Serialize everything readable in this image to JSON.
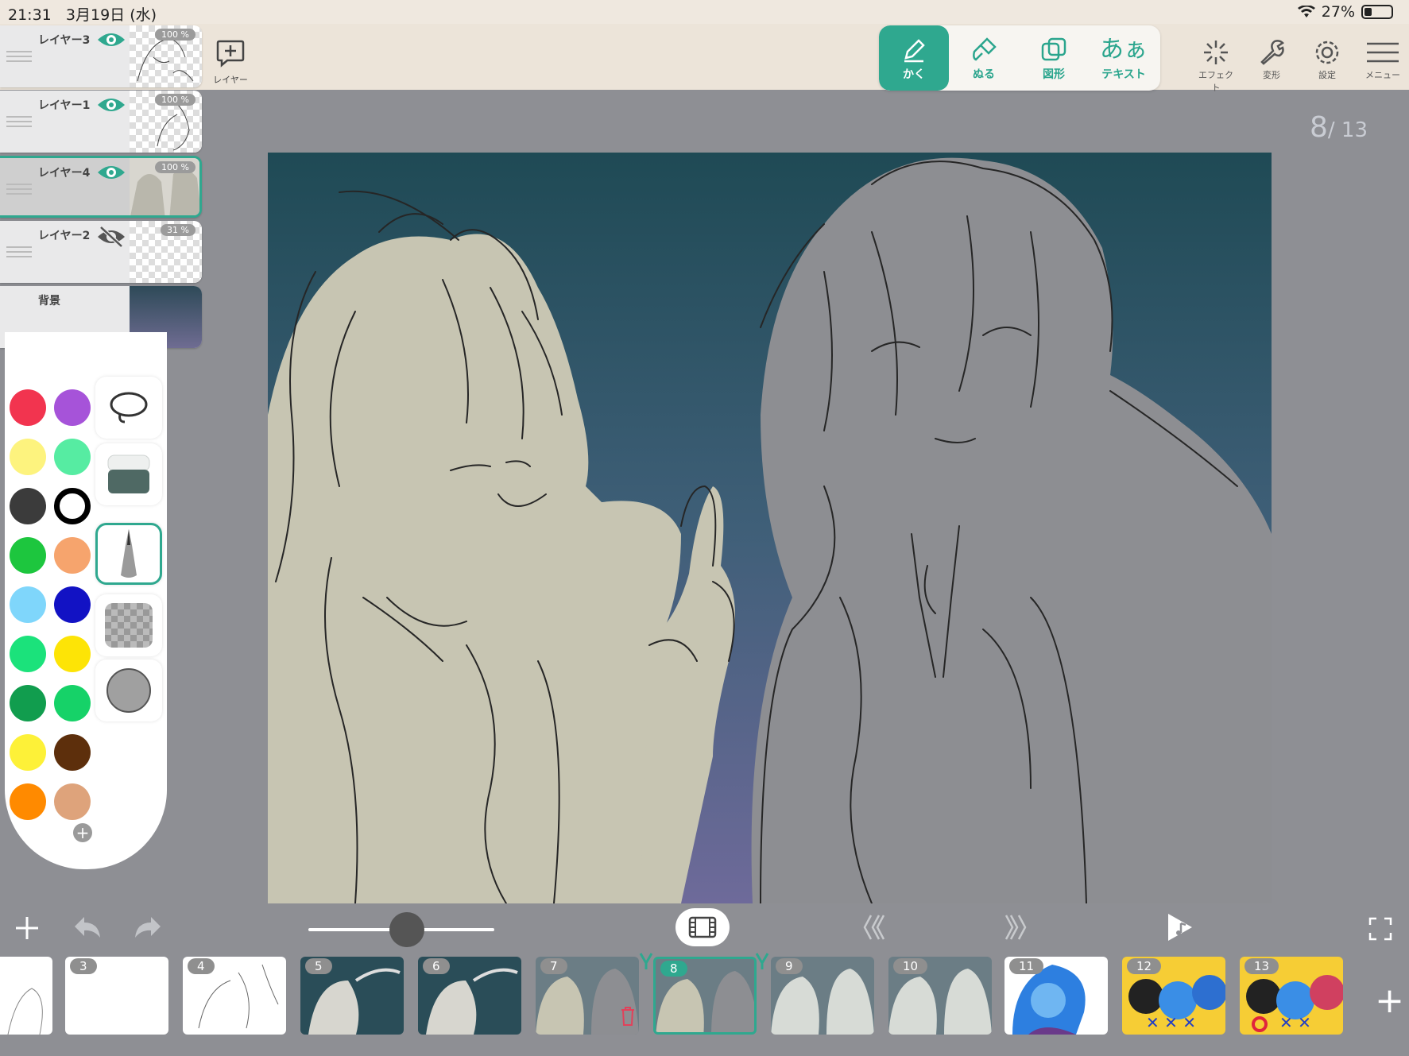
{
  "status_bar": {
    "time": "21:31",
    "date": "3月19日 (水)",
    "battery": "27%"
  },
  "toolbar": {
    "layer_add_label": "レイヤー",
    "tools": [
      {
        "label": "かく",
        "icon": "pencil-icon",
        "active": true
      },
      {
        "label": "ぬる",
        "icon": "brush-icon",
        "active": false
      },
      {
        "label": "図形",
        "icon": "shape-icon",
        "active": false
      },
      {
        "label": "テキスト",
        "icon": "text-icon",
        "glyph": "あぁ",
        "active": false
      }
    ],
    "right_tools": [
      {
        "label": "エフェクト",
        "icon": "effect-sparkle-icon"
      },
      {
        "label": "変形",
        "icon": "wrench-icon"
      },
      {
        "label": "設定",
        "icon": "gear-icon"
      },
      {
        "label": "メニュー",
        "icon": "hamburger-menu-icon"
      }
    ]
  },
  "page_counter": {
    "current": "8",
    "total": "/ 13"
  },
  "layers": [
    {
      "name": "レイヤー3",
      "visible": true,
      "opacity": "100 %",
      "selected": false
    },
    {
      "name": "レイヤー1",
      "visible": true,
      "opacity": "100 %",
      "selected": false
    },
    {
      "name": "レイヤー4",
      "visible": true,
      "opacity": "100 %",
      "selected": true
    },
    {
      "name": "レイヤー2",
      "visible": false,
      "opacity": "31 %",
      "selected": false
    },
    {
      "name": "背景",
      "visible": true,
      "opacity": "",
      "selected": false
    }
  ],
  "palette": {
    "colors": [
      "#f2344f",
      "#a653d9",
      "#fdf37e",
      "#56eca2",
      "#3b3b3b",
      "#ffffff",
      "#1dc63e",
      "#f6a46d",
      "#7fd6fb",
      "#1212c4",
      "#1be27b",
      "#fde406",
      "#119d4e",
      "#16d268",
      "#fdf138",
      "#5d2f0c",
      "#ff8a00",
      "#dea37b"
    ],
    "tools": [
      "lasso-icon",
      "eraser-icon",
      "pen-nib-icon",
      "transparent-color-icon",
      "gray-color-icon"
    ],
    "selected_tool": "pen-nib-icon"
  },
  "timeline": {
    "current_frame": 8,
    "frames": [
      {
        "num": "",
        "style": "sketch-light"
      },
      {
        "num": "3",
        "style": "blank"
      },
      {
        "num": "4",
        "style": "sketch-light"
      },
      {
        "num": "5",
        "style": "teal"
      },
      {
        "num": "6",
        "style": "teal"
      },
      {
        "num": "7",
        "style": "teal"
      },
      {
        "num": "8",
        "style": "teal"
      },
      {
        "num": "9",
        "style": "teal"
      },
      {
        "num": "10",
        "style": "teal"
      },
      {
        "num": "11",
        "style": "blue-char"
      },
      {
        "num": "12",
        "style": "yellow"
      },
      {
        "num": "13",
        "style": "yellow"
      }
    ]
  }
}
